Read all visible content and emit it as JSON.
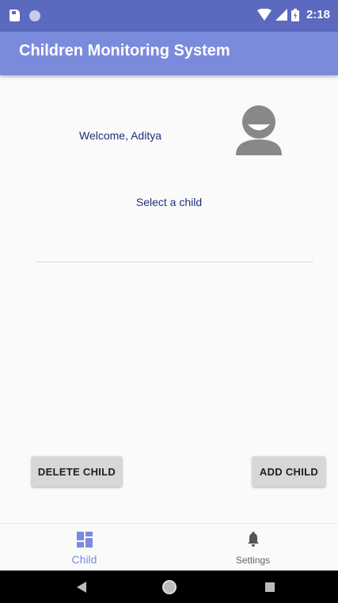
{
  "status_bar": {
    "time": "2:18"
  },
  "app_bar": {
    "title": "Children Monitoring System"
  },
  "main": {
    "welcome_text": "Welcome, Aditya",
    "select_label": "Select a child"
  },
  "actions": {
    "delete_label": "DELETE CHILD",
    "add_label": "ADD CHILD"
  },
  "bottom_nav": {
    "items": [
      {
        "label": "Child",
        "icon": "dashboard-icon",
        "active": true
      },
      {
        "label": "Settings",
        "icon": "bell-icon",
        "active": false
      }
    ]
  },
  "colors": {
    "status_bar": "#5b69bf",
    "app_bar": "#7b8bdc",
    "text_accent": "#22307a",
    "button_bg": "#d7d7d7"
  }
}
